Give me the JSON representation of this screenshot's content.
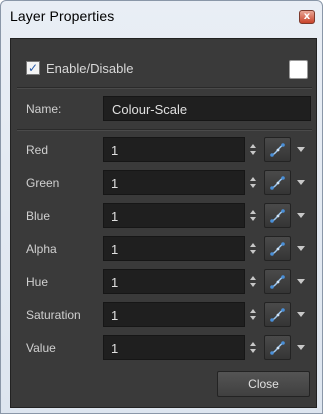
{
  "window": {
    "title": "Layer Properties",
    "close_glyph": "x"
  },
  "enable": {
    "label": "Enable/Disable",
    "checked": true,
    "check_glyph": "✓",
    "color_swatch": "#ffffff"
  },
  "name": {
    "label": "Name:",
    "value": "Colour-Scale"
  },
  "properties": [
    {
      "label": "Red",
      "value": "1"
    },
    {
      "label": "Green",
      "value": "1"
    },
    {
      "label": "Blue",
      "value": "1"
    },
    {
      "label": "Alpha",
      "value": "1"
    },
    {
      "label": "Hue",
      "value": "1"
    },
    {
      "label": "Saturation",
      "value": "1"
    },
    {
      "label": "Value",
      "value": "1"
    }
  ],
  "buttons": {
    "close_label": "Close"
  },
  "icons": {
    "function": "function-curve-icon",
    "spin": "spinner-icon",
    "dropdown": "dropdown-arrow-icon"
  },
  "colors": {
    "panel": "#3a3a3a",
    "field": "#1f1f1f",
    "accent": "#4a90d9"
  }
}
